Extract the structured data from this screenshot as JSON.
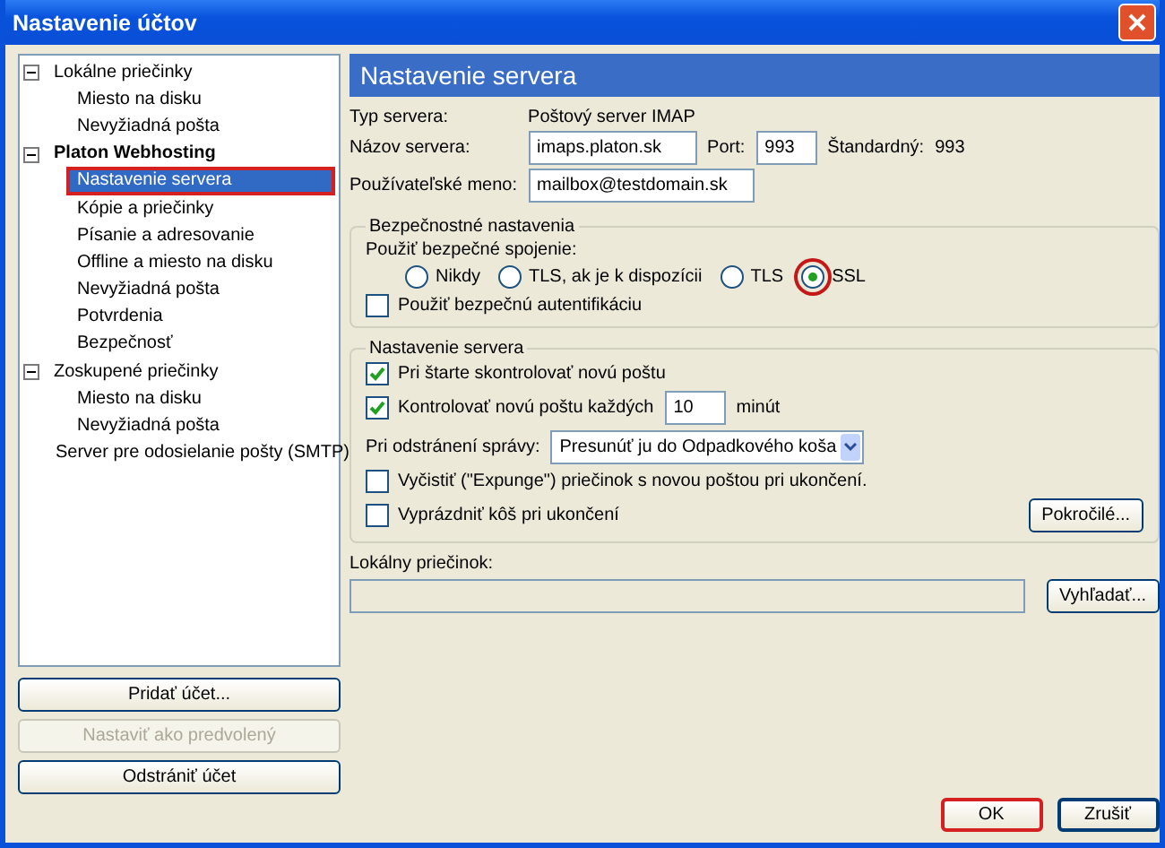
{
  "window": {
    "title": "Nastavenie účtov"
  },
  "tree": [
    {
      "label": "Lokálne priečinky",
      "bold": false,
      "expanded": true,
      "selected": false,
      "highlighted": false,
      "children": [
        {
          "label": "Miesto na disku",
          "selected": false,
          "highlighted": false
        },
        {
          "label": "Nevyžiadná pošta",
          "selected": false,
          "highlighted": false
        }
      ]
    },
    {
      "label": "Platon Webhosting",
      "bold": true,
      "expanded": true,
      "selected": false,
      "highlighted": false,
      "children": [
        {
          "label": "Nastavenie servera",
          "selected": true,
          "highlighted": true
        },
        {
          "label": "Kópie a priečinky",
          "selected": false,
          "highlighted": false
        },
        {
          "label": "Písanie a adresovanie",
          "selected": false,
          "highlighted": false
        },
        {
          "label": "Offline a miesto na disku",
          "selected": false,
          "highlighted": false
        },
        {
          "label": "Nevyžiadná pošta",
          "selected": false,
          "highlighted": false
        },
        {
          "label": "Potvrdenia",
          "selected": false,
          "highlighted": false
        },
        {
          "label": "Bezpečnosť",
          "selected": false,
          "highlighted": false
        }
      ]
    },
    {
      "label": "Zoskupené priečinky",
      "bold": false,
      "expanded": true,
      "selected": false,
      "highlighted": false,
      "children": [
        {
          "label": "Miesto na disku",
          "selected": false,
          "highlighted": false
        },
        {
          "label": "Nevyžiadná pošta",
          "selected": false,
          "highlighted": false
        }
      ]
    },
    {
      "label": "Server pre odosielanie pošty (SMTP)",
      "bold": false,
      "selected": false,
      "highlighted": false
    }
  ],
  "account_buttons": [
    {
      "label": "Pridať účet...",
      "disabled": false
    },
    {
      "label": "Nastaviť ako predvolený",
      "disabled": true
    },
    {
      "label": "Odstrániť účet",
      "disabled": false
    }
  ],
  "panel": {
    "title": "Nastavenie servera",
    "server_type": {
      "label": "Typ servera:",
      "value": "Poštový server IMAP"
    },
    "server_name": {
      "label": "Názov servera:",
      "value": "imaps.platon.sk"
    },
    "port": {
      "label": "Port:",
      "value": "993"
    },
    "default_port": {
      "label": "Štandardný:",
      "value": "993"
    },
    "username": {
      "label": "Používateľské meno:",
      "value": "mailbox@testdomain.sk"
    },
    "security": {
      "title": "Bezpečnostné nastavenia",
      "connection_label": "Použiť bezpečné spojenie:",
      "options": [
        {
          "label": "Nikdy",
          "selected": false,
          "highlighted": false
        },
        {
          "label": "TLS, ak je k dispozícii",
          "selected": false,
          "highlighted": false
        },
        {
          "label": "TLS",
          "selected": false,
          "highlighted": false
        },
        {
          "label": "SSL",
          "selected": true,
          "highlighted": true
        }
      ],
      "secure_auth": {
        "label": "Použiť bezpečnú autentifikáciu",
        "checked": false
      }
    },
    "server_settings": {
      "title": "Nastavenie servera",
      "check_on_start": {
        "label": "Pri štarte skontrolovať novú poštu",
        "checked": true
      },
      "check_every": {
        "label": "Kontrolovať novú poštu každých",
        "checked": true,
        "value": "10",
        "unit": "minút"
      },
      "on_delete": {
        "label": "Pri odstránení správy:",
        "value": "Presunúť ju do Odpadkového koša"
      },
      "expunge": {
        "label": "Vyčistiť (\"Expunge\") priečinok s novou poštou pri ukončení.",
        "checked": false
      },
      "empty_trash": {
        "label": "Vyprázdniť kôš pri ukončení",
        "checked": false
      },
      "advanced_button": "Pokročilé..."
    },
    "local_folder": {
      "label": "Lokálny priečinok:",
      "browse_button": "Vyhľadať..."
    }
  },
  "dialog_buttons": [
    {
      "label": "OK",
      "highlighted": true
    },
    {
      "label": "Zrušiť",
      "highlighted": false
    }
  ]
}
